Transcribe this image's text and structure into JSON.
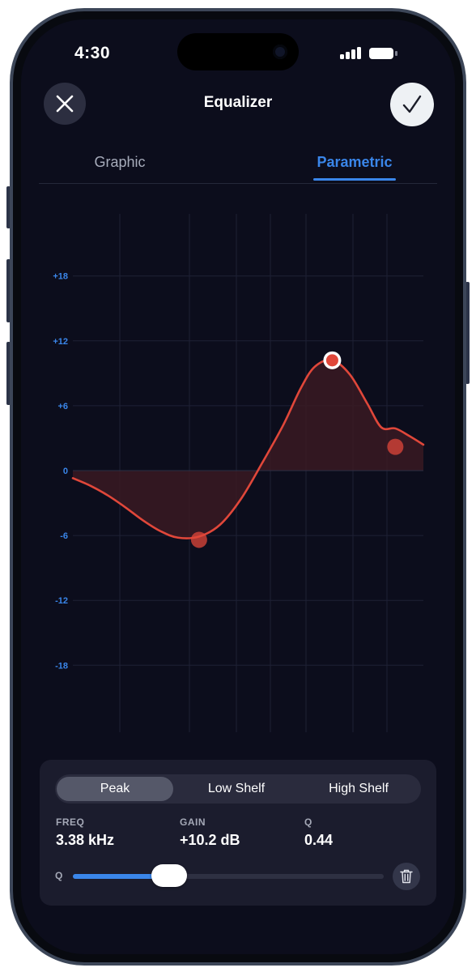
{
  "status_bar": {
    "time": "4:30"
  },
  "header": {
    "title": "Equalizer",
    "close_icon": "close-icon",
    "confirm_icon": "checkmark-icon"
  },
  "tabs": [
    {
      "label": "Graphic",
      "active": false
    },
    {
      "label": "Parametric",
      "active": true
    }
  ],
  "chart_data": {
    "type": "line",
    "title": "",
    "xlabel": "",
    "ylabel": "",
    "ylim": [
      -24,
      24
    ],
    "y_ticks": [
      "+18",
      "+12",
      "+6",
      "0",
      "-6",
      "-12",
      "-18"
    ],
    "y_tick_values": [
      18,
      12,
      6,
      0,
      -6,
      -12,
      -18
    ],
    "grid": true,
    "series": [
      {
        "values": [
          [
            0.0,
            -0.7
          ],
          [
            0.05,
            -1.4
          ],
          [
            0.1,
            -2.3
          ],
          [
            0.15,
            -3.4
          ],
          [
            0.2,
            -4.6
          ],
          [
            0.25,
            -5.6
          ],
          [
            0.3,
            -6.2
          ],
          [
            0.36,
            -6.1
          ],
          [
            0.42,
            -5.0
          ],
          [
            0.48,
            -2.6
          ],
          [
            0.54,
            0.7
          ],
          [
            0.6,
            4.2
          ],
          [
            0.65,
            7.6
          ],
          [
            0.69,
            9.6
          ],
          [
            0.74,
            10.2
          ],
          [
            0.79,
            8.9
          ],
          [
            0.84,
            6.2
          ],
          [
            0.88,
            4.0
          ],
          [
            0.92,
            3.9
          ],
          [
            0.96,
            3.2
          ],
          [
            1.0,
            2.4
          ]
        ]
      }
    ],
    "band_nodes": [
      {
        "position": 0.36,
        "gain": -6.4,
        "selected": false
      },
      {
        "position": 0.74,
        "gain": 10.2,
        "selected": true
      },
      {
        "position": 0.92,
        "gain": 2.2,
        "selected": false
      }
    ],
    "colors": {
      "curve": "#e0473a",
      "fill": "#3a1a22",
      "tick": "#3a86ea",
      "grid": "#1e2135"
    }
  },
  "panel": {
    "filter_types": [
      {
        "label": "Peak",
        "active": true
      },
      {
        "label": "Low Shelf",
        "active": false
      },
      {
        "label": "High Shelf",
        "active": false
      }
    ],
    "freq": {
      "label": "FREQ",
      "value": "3.38 kHz"
    },
    "gain": {
      "label": "GAIN",
      "value": "+10.2 dB"
    },
    "q": {
      "label": "Q",
      "value": "0.44"
    },
    "q_slider": {
      "label": "Q",
      "fraction": 0.31
    },
    "delete_icon": "trash-icon"
  },
  "colors": {
    "accent": "#3a86ea",
    "curve": "#e0473a",
    "background": "#0c0d1c",
    "panel": "#1b1c2d"
  }
}
